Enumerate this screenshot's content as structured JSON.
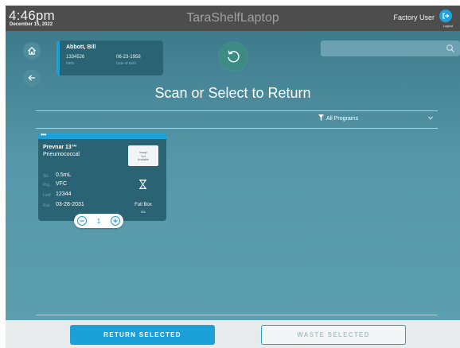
{
  "header": {
    "time": "4:46pm",
    "date": "December 15, 2022",
    "app_title": "TaraShelfLaptop",
    "user_name": "Factory User",
    "logout_label": "Logout"
  },
  "patient": {
    "name": "Abbott, Bill",
    "mrn": "1334526",
    "mrn_label": "MRN",
    "dob": "06-23-1958",
    "dob_label": "Date of Birth"
  },
  "search": {
    "placeholder": ""
  },
  "page_title": "Scan or Select to Return",
  "filter": {
    "label": "All Programs"
  },
  "product": {
    "name": "Prevnar 13™",
    "subtitle": "Pneumococcal",
    "image_text": [
      "Image",
      "Not",
      "Available"
    ],
    "fields": [
      {
        "label": "Str.",
        "value": "0.5mL"
      },
      {
        "label": "Prg.",
        "value": "VFC"
      },
      {
        "label": "Lot#",
        "value": "12344"
      },
      {
        "label": "Exp.",
        "value": "03-28-2031"
      }
    ],
    "package": "Full Box",
    "unit": "EA",
    "quantity": "1"
  },
  "actions": {
    "return_label": "RETURN SELECTED",
    "waste_label": "WASTE SELECTED"
  },
  "colors": {
    "accent": "#1ba0d8",
    "header_bg": "#4d4d4d",
    "card_bg": "#2a6373"
  },
  "icons": [
    "home-icon",
    "back-arrow-icon",
    "reset-icon",
    "search-icon",
    "filter-icon",
    "chevron-down-icon",
    "logout-icon",
    "hourglass-icon",
    "minus-icon",
    "plus-icon"
  ]
}
